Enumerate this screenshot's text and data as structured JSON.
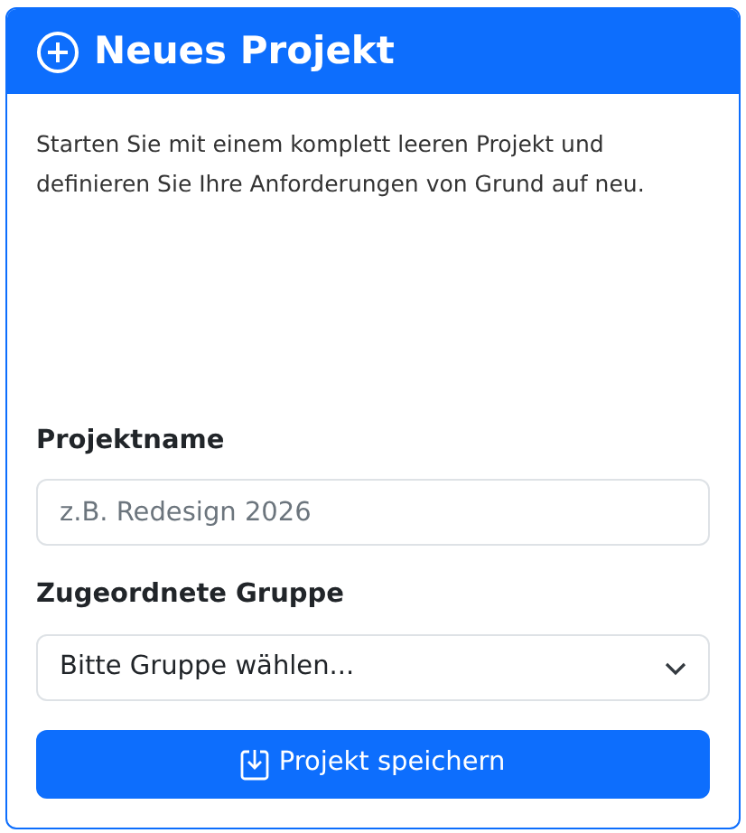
{
  "card": {
    "title": "Neues Projekt",
    "description": "Starten Sie mit einem komplett leeren Projekt und definieren Sie Ihre Anforderungen von Grund auf neu."
  },
  "form": {
    "name_label": "Projektname",
    "name_placeholder": "z.B. Redesign 2026",
    "group_label": "Zugeordnete Gruppe",
    "group_value": "Bitte Gruppe wählen...",
    "submit": "Projekt speichern"
  }
}
